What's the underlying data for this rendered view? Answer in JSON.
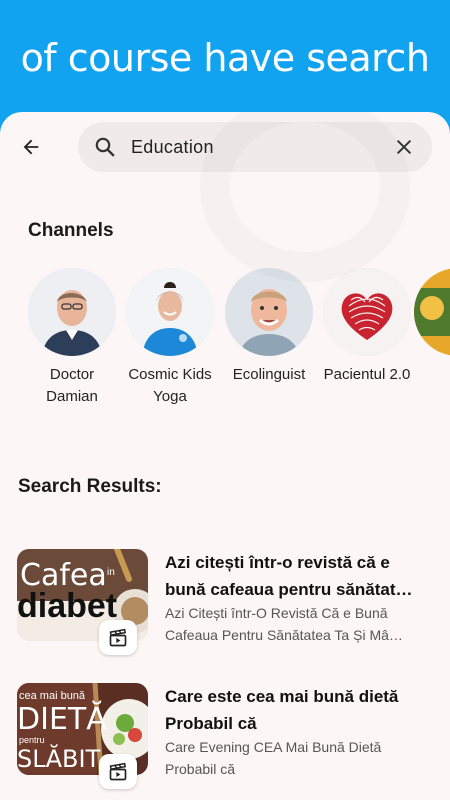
{
  "banner": {
    "text": "of course have search"
  },
  "search": {
    "value": "Education"
  },
  "channels": {
    "title": "Channels",
    "items": [
      {
        "name": "Doctor Damian"
      },
      {
        "name": "Cosmic Kids Yoga"
      },
      {
        "name": "Ecolinguist"
      },
      {
        "name": "Pacientul 2.0"
      }
    ]
  },
  "results": {
    "title": "Search Results:",
    "items": [
      {
        "title": "Azi citești într-o revistă că e bună cafeaua pentru sănătat…",
        "description": "Azi Citești într-O Revistă Că e Bună Cafeaua Pentru Sănătatea Ta Și Mâ…",
        "thumb_text_1": "Cafea",
        "thumb_text_small": "in",
        "thumb_text_2": "diabet"
      },
      {
        "title": "Care este cea mai bună dietă Probabil că",
        "description": "Care Evening CEA Mai Bună Dietă Probabil că",
        "thumb_text_1": "cea mai bună",
        "thumb_text_2": "DIETĂ",
        "thumb_text_small": "pentru",
        "thumb_text_3": "SLĂBIT"
      }
    ]
  },
  "colors": {
    "accent": "#12A3F0",
    "page_bg": "#FCF7F6",
    "search_bg": "#F0EBEA"
  },
  "icons": [
    "back-arrow-icon",
    "search-icon",
    "close-icon",
    "video-clip-icon"
  ]
}
